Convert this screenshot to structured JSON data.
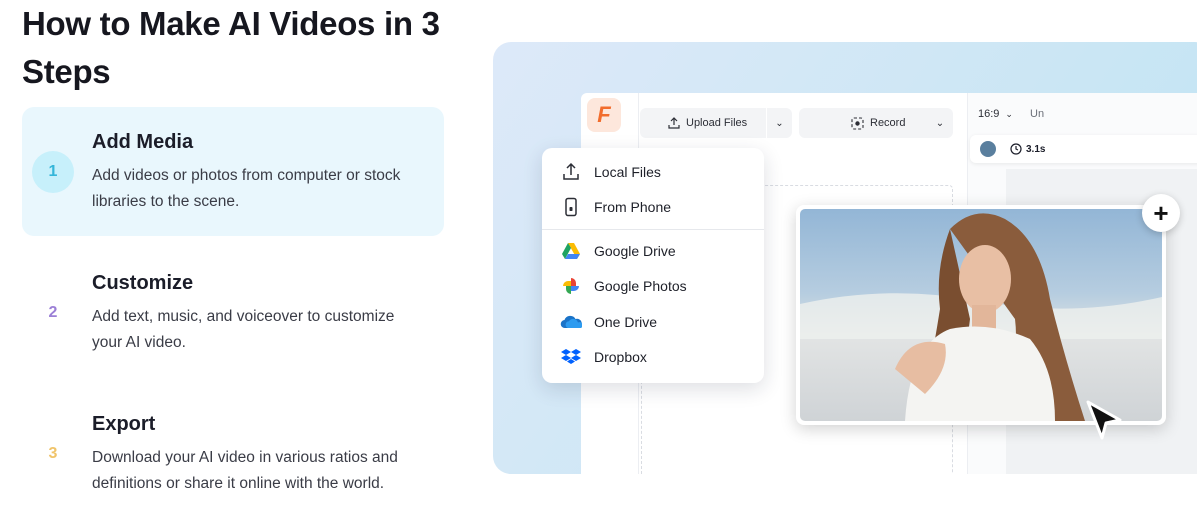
{
  "headline": "How to Make AI Videos in 3 Steps",
  "steps": [
    {
      "number": "1",
      "title": "Add Media",
      "description": "Add videos or photos from computer or stock libraries to the scene.",
      "color": "#34b6d9"
    },
    {
      "number": "2",
      "title": "Customize",
      "description": "Add text, music, and voiceover to customize your AI video.",
      "color": "#9b7fd6"
    },
    {
      "number": "3",
      "title": "Export",
      "description": "Download your AI video in various ratios and definitions or share it online with the world.",
      "color": "#f0c46a"
    }
  ],
  "editor": {
    "logo": "F",
    "upload_label": "Upload Files",
    "record_label": "Record",
    "ratio": "16:9",
    "ratio_extra": "Un",
    "duration": "3.1s"
  },
  "upload_menu": {
    "items": [
      {
        "label": "Local Files",
        "icon": "upload-icon"
      },
      {
        "label": "From Phone",
        "icon": "phone-icon"
      },
      {
        "label": "Google Drive",
        "icon": "google-drive-icon"
      },
      {
        "label": "Google Photos",
        "icon": "google-photos-icon"
      },
      {
        "label": "One Drive",
        "icon": "onedrive-icon"
      },
      {
        "label": "Dropbox",
        "icon": "dropbox-icon"
      }
    ]
  },
  "colors": {
    "accent": "#34b6d9",
    "logo": "#f26c2c"
  }
}
